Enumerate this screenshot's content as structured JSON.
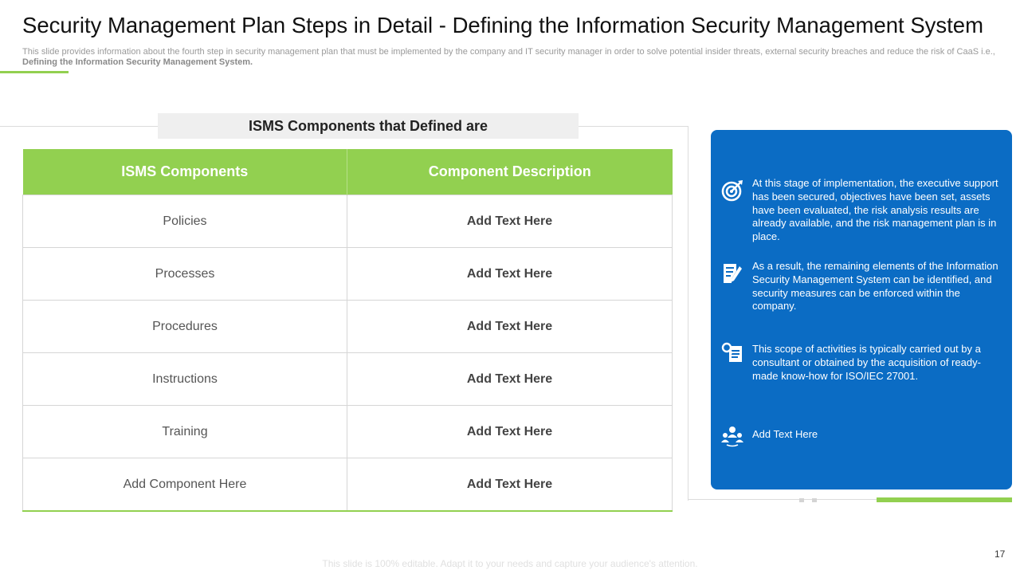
{
  "slide": {
    "title": "Security Management Plan Steps in Detail - Defining the Information Security Management System",
    "subtitle_text": "This slide provides information about the fourth step in security management plan that must be implemented by the company and IT security manager in order to solve potential insider threats, external security breaches and reduce the risk of CaaS i.e.,",
    "subtitle_bold": "Defining the Information Security Management System.",
    "footer": "This slide is 100% editable. Adapt it to your needs and capture your audience's attention.",
    "page_number": "17"
  },
  "table": {
    "heading": "ISMS Components that Defined are",
    "columns": [
      "ISMS Components",
      "Component Description"
    ],
    "rows": [
      [
        "Policies",
        "Add Text Here"
      ],
      [
        "Processes",
        "Add Text Here"
      ],
      [
        "Procedures",
        "Add Text Here"
      ],
      [
        "Instructions",
        "Add Text Here"
      ],
      [
        "Training",
        "Add Text Here"
      ],
      [
        "Add Component Here",
        "Add Text Here"
      ]
    ]
  },
  "panel": {
    "points": [
      {
        "icon": "target-icon",
        "text": "At this stage of implementation, the executive support has been secured, objectives have been set, assets have been evaluated, the risk analysis results are already available, and the risk management plan is in place."
      },
      {
        "icon": "document-edit-icon",
        "text": "As a result, the remaining elements of the Information Security Management System can be identified, and security measures can be enforced within the company."
      },
      {
        "icon": "document-search-icon",
        "text": "This scope of activities is typically carried out by a consultant or obtained by the acquisition of ready-made know-how for ISO/IEC 27001."
      },
      {
        "icon": "team-icon",
        "text": "Add Text Here"
      }
    ]
  },
  "colors": {
    "accent_green": "#92d050",
    "panel_blue": "#0b6cc4",
    "heading_band": "#efefef"
  }
}
